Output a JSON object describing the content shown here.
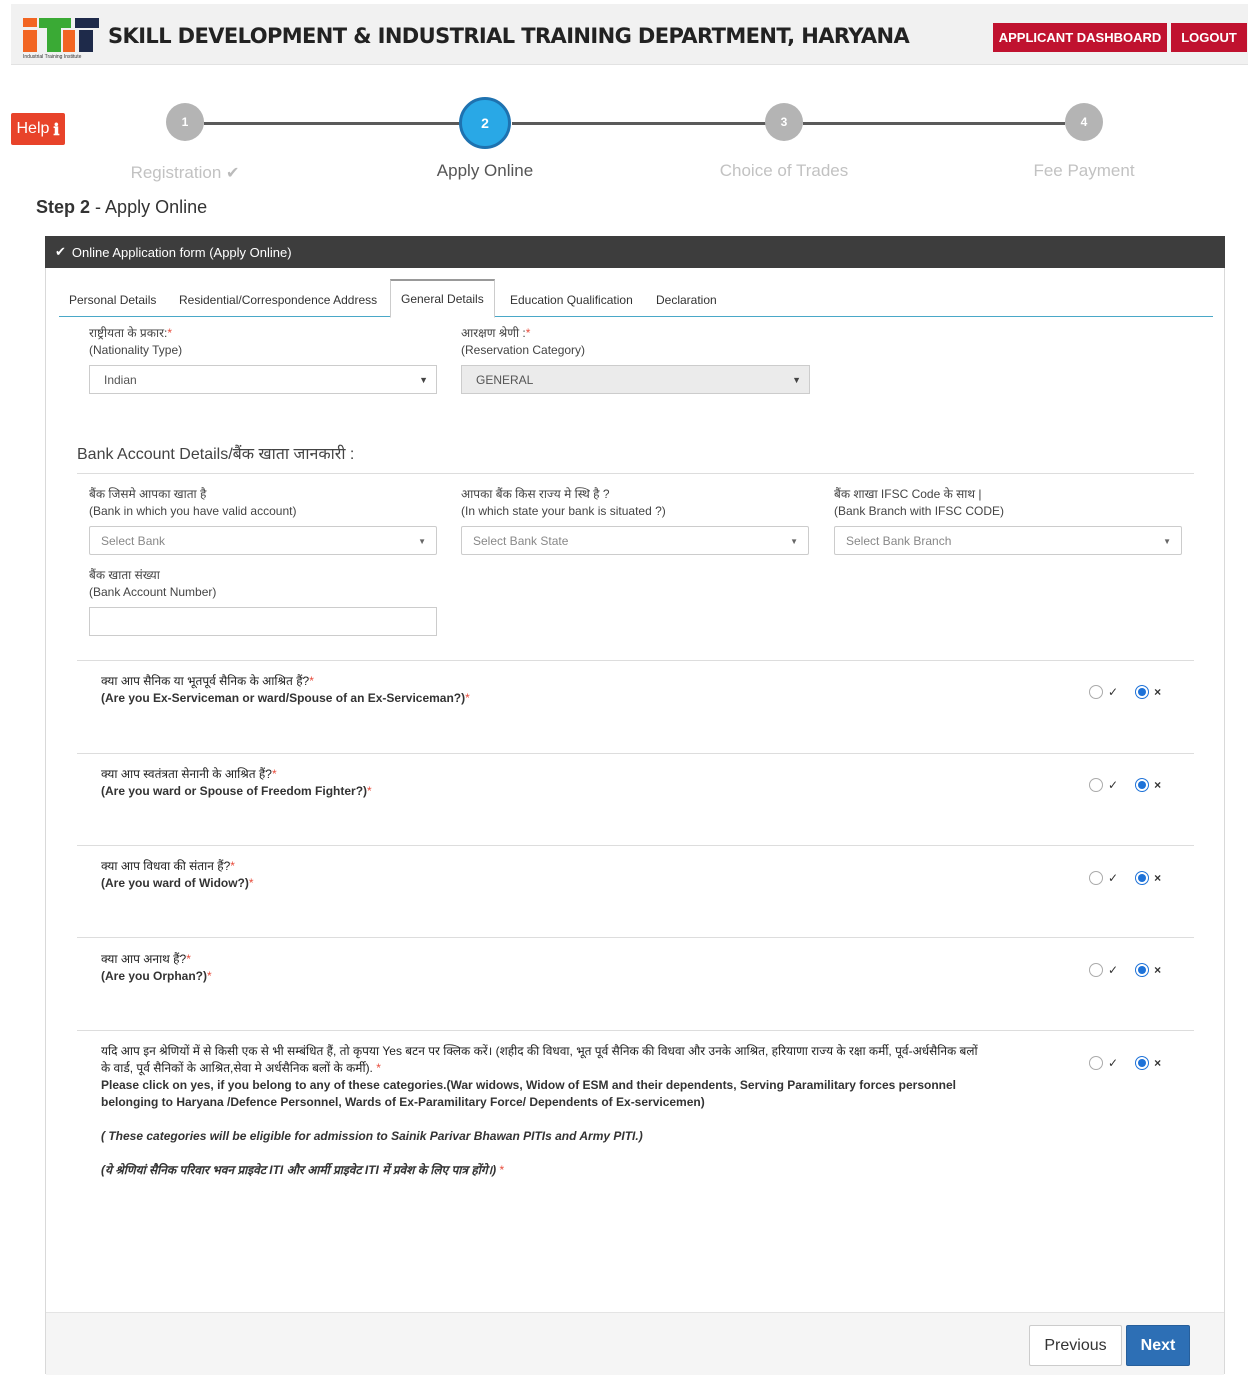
{
  "header": {
    "logo_sub": "Industrial Training Institute",
    "title": "SKILL DEVELOPMENT & INDUSTRIAL TRAINING DEPARTMENT, HARYANA",
    "dashboard_label": "APPLICANT DASHBOARD",
    "logout_label": "LOGOUT",
    "colors": {
      "header_button": "#c0122f",
      "logo_orange": "#f26522",
      "logo_green": "#3aaa35",
      "logo_dark": "#1e2a4a"
    }
  },
  "help": {
    "label": "Help",
    "icon": "info-icon"
  },
  "stepper": {
    "steps": [
      {
        "number": "1",
        "label": "Registration",
        "completed": true
      },
      {
        "number": "2",
        "label": "Apply Online",
        "active": true
      },
      {
        "number": "3",
        "label": "Choice of Trades"
      },
      {
        "number": "4",
        "label": "Fee Payment"
      }
    ],
    "colors": {
      "active": "#29a8e6",
      "inactive": "#b4b4b4"
    }
  },
  "page_heading": {
    "step": "Step 2",
    "separator": " - ",
    "title": "Apply Online"
  },
  "panel": {
    "title": "Online Application form (Apply Online)",
    "tabs": [
      {
        "label": "Personal Details"
      },
      {
        "label": "Residential/Correspondence Address"
      },
      {
        "label": "General Details",
        "active": true
      },
      {
        "label": "Education Qualification"
      },
      {
        "label": "Declaration"
      }
    ]
  },
  "general": {
    "nationality": {
      "label_hi": "राष्ट्रीयता के प्रकार:",
      "label_en": "(Nationality Type)",
      "value": "Indian"
    },
    "reservation": {
      "label_hi": "आरक्षण श्रेणी :",
      "label_en": "(Reservation Category)",
      "value": "GENERAL"
    }
  },
  "bank": {
    "section_title": "Bank Account Details/बैंक खाता जानकारी :",
    "bank_name": {
      "label_hi": "बैंक जिसमे आपका खाता है",
      "label_en": "(Bank in which you have valid account)",
      "placeholder": "Select Bank"
    },
    "bank_state": {
      "label_hi": "आपका बैंक किस राज्य मे स्थि है ?",
      "label_en": "(In which state your bank is situated ?)",
      "placeholder": "Select Bank State"
    },
    "bank_branch": {
      "label_hi": "बैंक शाखा IFSC Code के साथ |",
      "label_en": "(Bank Branch with IFSC CODE)",
      "placeholder": "Select Bank Branch"
    },
    "account_number": {
      "label_hi": "बैंक खाता संख्या",
      "label_en": "(Bank Account Number)",
      "value": ""
    }
  },
  "questions": [
    {
      "hi": "क्या आप सैनिक या भूतपूर्व सैनिक के आश्रित हैं?",
      "en": "(Are you Ex-Serviceman or ward/Spouse of an Ex-Serviceman?)",
      "yes": "✓",
      "no": "×",
      "selected": "no"
    },
    {
      "hi": "क्या आप स्वतंत्रता सेनानी के आश्रित हैं?",
      "en": "(Are you ward or Spouse of Freedom Fighter?)",
      "yes": "✓",
      "no": "×",
      "selected": "no"
    },
    {
      "hi": "क्या आप विधवा की संतान हैं?",
      "en": "(Are you ward of Widow?)",
      "yes": "✓",
      "no": "×",
      "selected": "no"
    },
    {
      "hi": "क्या आप अनाथ हैं?",
      "en": "(Are you Orphan?)",
      "yes": "✓",
      "no": "×",
      "selected": "no"
    }
  ],
  "last_question": {
    "hi": "यदि आप इन श्रेणियों में से किसी एक से भी सम्बंधित हैं, तो कृपया Yes बटन पर क्लिक करें। (शहीद की विधवा, भूत पूर्व सैनिक की विधवा और उनके आश्रित, हरियाणा राज्य के रक्षा कर्मी, पूर्व-अर्धसैनिक बलों के वार्ड, पूर्व सैनिकों के आश्रित,सेवा मे अर्धसैनिक बलों के कर्मी).",
    "en": "Please click on yes, if you belong to any of these categories.(War widows, Widow of ESM and their dependents, Serving Paramilitary forces personnel belonging to Haryana /Defence Personnel, Wards of Ex-Paramilitary Force/ Dependents of Ex-servicemen)",
    "note_en": "( These categories will be eligible for admission to Sainik Parivar Bhawan PITIs and Army PITI.)",
    "note_hi": "(ये श्रेणियां सैनिक परिवार भवन प्राइवेट ITI और आर्मी प्राइवेट ITI में प्रवेश के लिए पात्र होंगे।)",
    "yes": "✓",
    "no": "×",
    "selected": "no"
  },
  "required_mark": "*",
  "footer": {
    "previous_label": "Previous",
    "next_label": "Next"
  }
}
